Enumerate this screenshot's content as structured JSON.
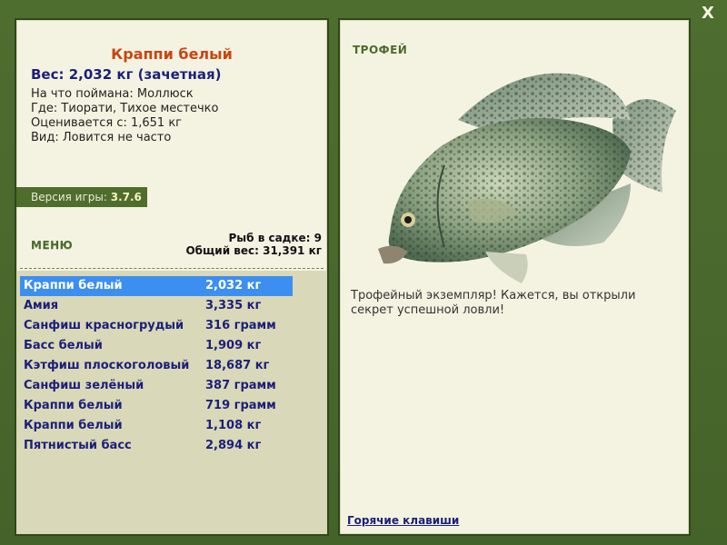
{
  "window": {
    "close_label": "X"
  },
  "fish": {
    "title": "Краппи белый",
    "weight_line": "Вес: 2,032 кг (зачетная)",
    "details": [
      "На что поймана: Моллюск",
      "Где: Тиорати, Тихое местечко",
      "Оценивается с: 1,651 кг",
      "Вид: Ловится не часто"
    ]
  },
  "version": {
    "label": "Версия игры:",
    "value": "3.7.6"
  },
  "menu_label": "МЕНЮ",
  "creel": {
    "count": "Рыб в садке: 9",
    "total_weight": "Общий вес: 31,391 кг"
  },
  "fish_list": [
    {
      "name": "Краппи белый",
      "weight": "2,032 кг"
    },
    {
      "name": "Амия",
      "weight": "3,335 кг"
    },
    {
      "name": "Санфиш красногрудый",
      "weight": "316 грамм"
    },
    {
      "name": "Басс белый",
      "weight": "1,909 кг"
    },
    {
      "name": "Кэтфиш плоскоголовый",
      "weight": "18,687 кг"
    },
    {
      "name": "Санфиш зелёный",
      "weight": "387 грамм"
    },
    {
      "name": "Краппи белый",
      "weight": "719 грамм"
    },
    {
      "name": "Краппи белый",
      "weight": "1,108 кг"
    },
    {
      "name": "Пятнистый басс",
      "weight": "2,894 кг"
    }
  ],
  "selected_index": 0,
  "trophy": {
    "label": "ТРОФЕЙ",
    "text": "Трофейный экземпляр! Кажется, вы открыли секрет успешной ловли!"
  },
  "hotkeys_label": "Горячие клавиши",
  "colors": {
    "frame": "#4a6a2c",
    "panel": "#f4f3e1",
    "title": "#c94512",
    "text_blue": "#1b1f7a",
    "selection": "#3c8ef0"
  },
  "icons": {
    "fish_picture": "crappie-fish-image",
    "close": "close-icon"
  }
}
